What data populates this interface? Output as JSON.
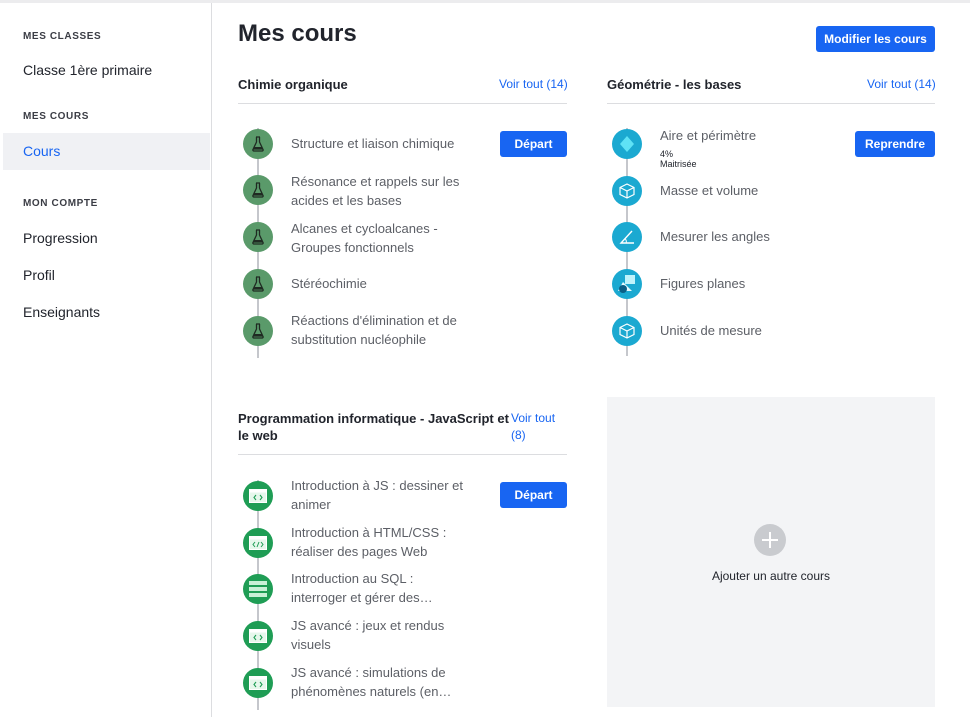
{
  "sidebar": {
    "sections": [
      {
        "heading": "MES CLASSES",
        "items": [
          {
            "label": "Classe 1ère primaire",
            "active": false
          }
        ]
      },
      {
        "heading": "MES COURS",
        "items": [
          {
            "label": "Cours",
            "active": true
          }
        ]
      },
      {
        "heading": "MON COMPTE",
        "items": [
          {
            "label": "Progression",
            "active": false
          },
          {
            "label": "Profil",
            "active": false
          },
          {
            "label": "Enseignants",
            "active": false
          }
        ]
      }
    ]
  },
  "main": {
    "title": "Mes cours",
    "edit_button": "Modifier les cours",
    "courses": [
      {
        "title": "Chimie organique",
        "see_all": "Voir tout (14)",
        "action": "Départ",
        "icon": "flask-icon",
        "units": [
          {
            "label": "Structure et liaison chimique"
          },
          {
            "label": "Résonance et rappels sur les acides et les bases"
          },
          {
            "label": "Alcanes et cycloalcanes - Groupes fonctionnels"
          },
          {
            "label": "Stéréochimie"
          },
          {
            "label": "Réactions d'élimination et de substitution nucléophile"
          }
        ]
      },
      {
        "title": "Géométrie - les bases",
        "see_all": "Voir tout (14)",
        "action": "Reprendre",
        "units": [
          {
            "label": "Aire et périmètre",
            "sub": "4% Maitrisée",
            "icon": "diamond-icon"
          },
          {
            "label": "Masse et volume",
            "icon": "cube-icon"
          },
          {
            "label": "Mesurer les angles",
            "icon": "angle-icon"
          },
          {
            "label": "Figures planes",
            "icon": "shapes-icon"
          },
          {
            "label": "Unités de mesure",
            "icon": "cube-icon"
          }
        ]
      },
      {
        "title": "Programmation informatique - JavaScript et le web",
        "see_all": "Voir tout (8)",
        "action": "Départ",
        "units": [
          {
            "label": "Introduction à JS : dessiner et animer",
            "icon": "code-window-icon"
          },
          {
            "label": "Introduction à HTML/CSS : réaliser des pages Web",
            "icon": "html-tag-icon"
          },
          {
            "label": "Introduction au SQL : interroger et gérer des…",
            "icon": "database-icon"
          },
          {
            "label": "JS avancé : jeux et rendus visuels",
            "icon": "code-window-icon"
          },
          {
            "label": "JS avancé : simulations de phénomènes naturels (en…",
            "icon": "code-window-icon"
          }
        ]
      }
    ],
    "add_course": "Ajouter un autre cours"
  },
  "colors": {
    "accent": "#1865f2",
    "chemistry": "#5a9a6a",
    "geometry": "#1ba9d1",
    "programming": "#1f9d55"
  }
}
